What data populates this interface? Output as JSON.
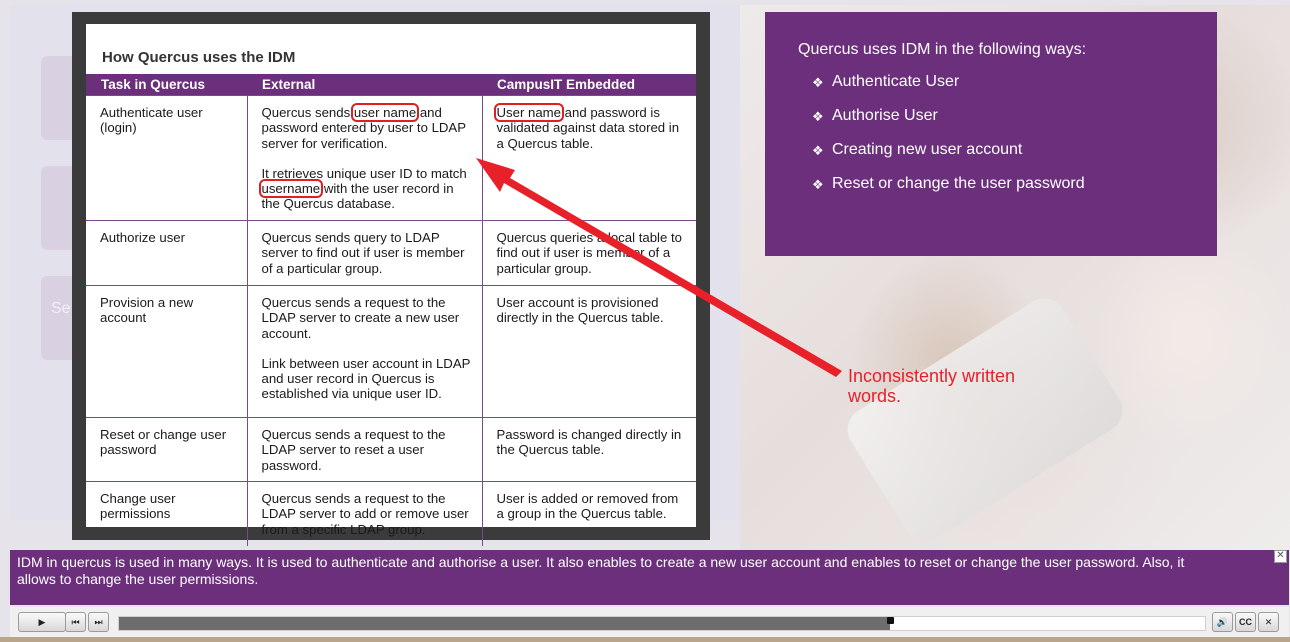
{
  "slide": {
    "ghost_button_label": "Se"
  },
  "info_panel": {
    "title": "Quercus uses IDM in the following ways:",
    "items": [
      "Authenticate User",
      "Authorise User",
      "Creating new user account",
      "Reset or change the user password"
    ],
    "bullet_glyph": "❖",
    "background": "#6b2f7c"
  },
  "table": {
    "title": "How Quercus uses the IDM",
    "headers": [
      "Task in Quercus",
      "External",
      "CampusIT Embedded"
    ],
    "rows": [
      {
        "task": "Authenticate user (login)",
        "external_pre": "Quercus sends ",
        "external_hl": "user name",
        "external_post": " and password entered by user to LDAP server for verification.",
        "external2_pre": "It retrieves unique user ID to match ",
        "external2_hl": "username",
        "external2_post": " with the user record in the Quercus database.",
        "embedded_hl": "User name",
        "embedded_post": " and password is validated against data stored in a Quercus table."
      },
      {
        "task": "Authorize user",
        "external": "Quercus sends query to LDAP server to find out if user is member of a particular group.",
        "embedded": "Quercus queries a local table to find out if user is member of a particular group."
      },
      {
        "task": "Provision a new account",
        "external": "Quercus sends a request to the LDAP server to create a new user account.",
        "external2": "Link between user account in LDAP and user record in Quercus is established via unique user ID.",
        "embedded": "User account is provisioned directly in the Quercus table."
      },
      {
        "task": "Reset or change user password",
        "external": "Quercus sends a request to the LDAP server to reset a user password.",
        "embedded": "Password is changed directly in the Quercus table."
      },
      {
        "task": "Change user permissions",
        "external": "Quercus sends a request to the LDAP server to add or remove user from a specific LDAP group.",
        "embedded": "User is added or removed from a group in the Quercus table."
      }
    ]
  },
  "annotation": {
    "text": "Inconsistently written words.",
    "color": "#e8202a"
  },
  "caption": {
    "text": "IDM in quercus is used in many ways. It is used to authenticate and authorise a user. It also enables to create a new user account and enables to reset or change the user password. Also, it allows to change the user permissions.",
    "close_glyph": "✕"
  },
  "player": {
    "play_icon": "▶",
    "prev_icon": "⏮",
    "next_icon": "⏭",
    "volume_icon": "🔊",
    "cc_label": "CC",
    "close_icon": "✕",
    "progress": 0.71
  }
}
